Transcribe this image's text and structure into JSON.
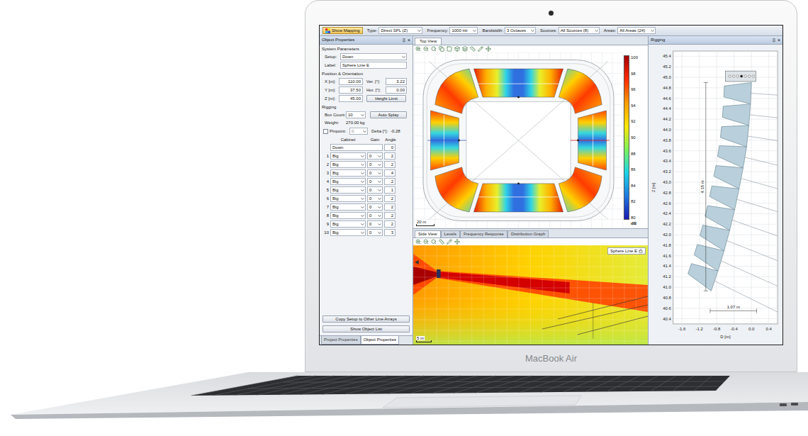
{
  "toolbar": {
    "show_mapping": "Show Mapping",
    "fields": [
      {
        "label": "Type:",
        "value": "Direct SPL (Z)"
      },
      {
        "label": "Frequency:",
        "value": "1000 Hz"
      },
      {
        "label": "Bandwidth:",
        "value": "3 Octaves"
      },
      {
        "label": "Sources:",
        "value": "All Sources (8)"
      },
      {
        "label": "Areas:",
        "value": "All Areas (24)"
      }
    ]
  },
  "object_properties": {
    "title": "Object Properties",
    "close": "×",
    "system_parameters": "System Parameters",
    "setup": {
      "label": "Setup:",
      "value": "Down"
    },
    "name": {
      "label": "Label:",
      "value": "Sphere Line E"
    },
    "position_title": "Position & Orientation",
    "position": [
      {
        "label": "X [m]:",
        "value": "110.00"
      },
      {
        "label": "Y [m]:",
        "value": "37.50"
      },
      {
        "label": "Z [m]:",
        "value": "45.00"
      }
    ],
    "orientation": [
      {
        "label": "Ver. [°]:",
        "value": "3.22"
      },
      {
        "label": "Hor. [°]:",
        "value": "0.00"
      }
    ],
    "height_limit": "Height Limit",
    "rigging_title": "Rigging",
    "box_count": {
      "label": "Box Count:",
      "value": "10"
    },
    "auto_splay": "Auto Splay",
    "weight": {
      "label": "Weight:",
      "value": "270.00 kg"
    },
    "pinpoint": {
      "label": "Pinpoint:",
      "checked": false,
      "value": "0",
      "delta_label": "Delta [°]:",
      "delta": "-0.28"
    },
    "columns": [
      "Cabinet",
      "Gain",
      "Angle"
    ],
    "setup_row": {
      "value": "Down",
      "angle": "0"
    },
    "cabinets": [
      {
        "index": "1",
        "type": "Big",
        "gain": "0",
        "angle": "2"
      },
      {
        "index": "2",
        "type": "Big",
        "gain": "0",
        "angle": "2"
      },
      {
        "index": "3",
        "type": "Big",
        "gain": "0",
        "angle": "4"
      },
      {
        "index": "4",
        "type": "Big",
        "gain": "0",
        "angle": "2"
      },
      {
        "index": "5",
        "type": "Big",
        "gain": "0",
        "angle": "1"
      },
      {
        "index": "6",
        "type": "Big",
        "gain": "0",
        "angle": "2"
      },
      {
        "index": "7",
        "type": "Big",
        "gain": "0",
        "angle": "2"
      },
      {
        "index": "8",
        "type": "Big",
        "gain": "0",
        "angle": "2"
      },
      {
        "index": "9",
        "type": "Big",
        "gain": "0",
        "angle": "2"
      },
      {
        "index": "10",
        "type": "Big",
        "gain": "0",
        "angle": "3"
      }
    ],
    "buttons": [
      "Copy Setup to Other Line Arrays",
      "Show Object List"
    ]
  },
  "bottom_tabs": [
    {
      "label": "Project Properties",
      "selected": false
    },
    {
      "label": "Object Properties",
      "selected": true
    }
  ],
  "top_view": {
    "tab": "Top View",
    "scale": "20 m",
    "colorbar": {
      "ticks": [
        "100",
        "98",
        "96",
        "94",
        "92",
        "90",
        "88",
        "86",
        "84",
        "82",
        "80"
      ],
      "unit": "dB"
    }
  },
  "side_tabs": [
    {
      "label": "Side View",
      "selected": true
    },
    {
      "label": "Levels",
      "selected": false
    },
    {
      "label": "Frequency Response",
      "selected": false
    },
    {
      "label": "Distribution Graph",
      "selected": false
    }
  ],
  "side_view": {
    "source": "Sphere Line E",
    "scale": "5 m"
  },
  "rigging": {
    "title": "Rigging",
    "close": "×",
    "y_label": "Z [m]",
    "x_label": "D [m]",
    "height": "4.15 m",
    "depth": "1.07 m",
    "y_ticks": [
      "45.4",
      "45.2",
      "45.0",
      "44.8",
      "44.6",
      "44.4",
      "44.2",
      "44.0",
      "43.8",
      "43.6",
      "43.4",
      "43.2",
      "43.0",
      "42.8",
      "42.6",
      "42.4",
      "42.2",
      "42.0",
      "41.8",
      "41.6",
      "41.4",
      "41.2",
      "41.0",
      "40.8",
      "40.6",
      "40.4"
    ],
    "x_ticks": [
      "-1.6",
      "-1.2",
      "-0.8",
      "-0.4",
      "0.0",
      "0.4"
    ],
    "pinpoints": [
      false,
      false,
      false,
      true,
      false,
      false,
      false
    ]
  },
  "device": {
    "label": "MacBook Air"
  }
}
